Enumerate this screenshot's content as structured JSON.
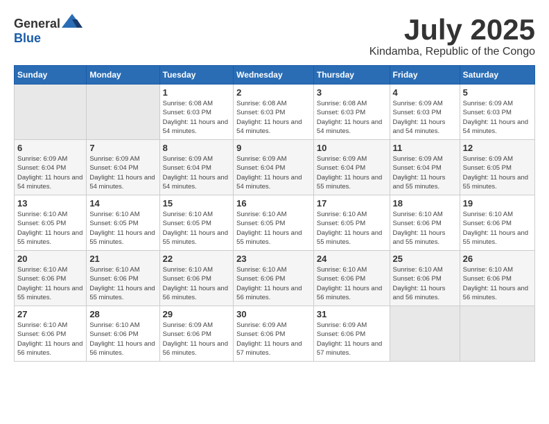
{
  "header": {
    "logo_general": "General",
    "logo_blue": "Blue",
    "month_year": "July 2025",
    "location": "Kindamba, Republic of the Congo"
  },
  "weekdays": [
    "Sunday",
    "Monday",
    "Tuesday",
    "Wednesday",
    "Thursday",
    "Friday",
    "Saturday"
  ],
  "weeks": [
    [
      {
        "day": "",
        "sunrise": "",
        "sunset": "",
        "daylight": ""
      },
      {
        "day": "",
        "sunrise": "",
        "sunset": "",
        "daylight": ""
      },
      {
        "day": "1",
        "sunrise": "Sunrise: 6:08 AM",
        "sunset": "Sunset: 6:03 PM",
        "daylight": "Daylight: 11 hours and 54 minutes."
      },
      {
        "day": "2",
        "sunrise": "Sunrise: 6:08 AM",
        "sunset": "Sunset: 6:03 PM",
        "daylight": "Daylight: 11 hours and 54 minutes."
      },
      {
        "day": "3",
        "sunrise": "Sunrise: 6:08 AM",
        "sunset": "Sunset: 6:03 PM",
        "daylight": "Daylight: 11 hours and 54 minutes."
      },
      {
        "day": "4",
        "sunrise": "Sunrise: 6:09 AM",
        "sunset": "Sunset: 6:03 PM",
        "daylight": "Daylight: 11 hours and 54 minutes."
      },
      {
        "day": "5",
        "sunrise": "Sunrise: 6:09 AM",
        "sunset": "Sunset: 6:03 PM",
        "daylight": "Daylight: 11 hours and 54 minutes."
      }
    ],
    [
      {
        "day": "6",
        "sunrise": "Sunrise: 6:09 AM",
        "sunset": "Sunset: 6:04 PM",
        "daylight": "Daylight: 11 hours and 54 minutes."
      },
      {
        "day": "7",
        "sunrise": "Sunrise: 6:09 AM",
        "sunset": "Sunset: 6:04 PM",
        "daylight": "Daylight: 11 hours and 54 minutes."
      },
      {
        "day": "8",
        "sunrise": "Sunrise: 6:09 AM",
        "sunset": "Sunset: 6:04 PM",
        "daylight": "Daylight: 11 hours and 54 minutes."
      },
      {
        "day": "9",
        "sunrise": "Sunrise: 6:09 AM",
        "sunset": "Sunset: 6:04 PM",
        "daylight": "Daylight: 11 hours and 54 minutes."
      },
      {
        "day": "10",
        "sunrise": "Sunrise: 6:09 AM",
        "sunset": "Sunset: 6:04 PM",
        "daylight": "Daylight: 11 hours and 55 minutes."
      },
      {
        "day": "11",
        "sunrise": "Sunrise: 6:09 AM",
        "sunset": "Sunset: 6:04 PM",
        "daylight": "Daylight: 11 hours and 55 minutes."
      },
      {
        "day": "12",
        "sunrise": "Sunrise: 6:09 AM",
        "sunset": "Sunset: 6:05 PM",
        "daylight": "Daylight: 11 hours and 55 minutes."
      }
    ],
    [
      {
        "day": "13",
        "sunrise": "Sunrise: 6:10 AM",
        "sunset": "Sunset: 6:05 PM",
        "daylight": "Daylight: 11 hours and 55 minutes."
      },
      {
        "day": "14",
        "sunrise": "Sunrise: 6:10 AM",
        "sunset": "Sunset: 6:05 PM",
        "daylight": "Daylight: 11 hours and 55 minutes."
      },
      {
        "day": "15",
        "sunrise": "Sunrise: 6:10 AM",
        "sunset": "Sunset: 6:05 PM",
        "daylight": "Daylight: 11 hours and 55 minutes."
      },
      {
        "day": "16",
        "sunrise": "Sunrise: 6:10 AM",
        "sunset": "Sunset: 6:05 PM",
        "daylight": "Daylight: 11 hours and 55 minutes."
      },
      {
        "day": "17",
        "sunrise": "Sunrise: 6:10 AM",
        "sunset": "Sunset: 6:05 PM",
        "daylight": "Daylight: 11 hours and 55 minutes."
      },
      {
        "day": "18",
        "sunrise": "Sunrise: 6:10 AM",
        "sunset": "Sunset: 6:06 PM",
        "daylight": "Daylight: 11 hours and 55 minutes."
      },
      {
        "day": "19",
        "sunrise": "Sunrise: 6:10 AM",
        "sunset": "Sunset: 6:06 PM",
        "daylight": "Daylight: 11 hours and 55 minutes."
      }
    ],
    [
      {
        "day": "20",
        "sunrise": "Sunrise: 6:10 AM",
        "sunset": "Sunset: 6:06 PM",
        "daylight": "Daylight: 11 hours and 55 minutes."
      },
      {
        "day": "21",
        "sunrise": "Sunrise: 6:10 AM",
        "sunset": "Sunset: 6:06 PM",
        "daylight": "Daylight: 11 hours and 55 minutes."
      },
      {
        "day": "22",
        "sunrise": "Sunrise: 6:10 AM",
        "sunset": "Sunset: 6:06 PM",
        "daylight": "Daylight: 11 hours and 56 minutes."
      },
      {
        "day": "23",
        "sunrise": "Sunrise: 6:10 AM",
        "sunset": "Sunset: 6:06 PM",
        "daylight": "Daylight: 11 hours and 56 minutes."
      },
      {
        "day": "24",
        "sunrise": "Sunrise: 6:10 AM",
        "sunset": "Sunset: 6:06 PM",
        "daylight": "Daylight: 11 hours and 56 minutes."
      },
      {
        "day": "25",
        "sunrise": "Sunrise: 6:10 AM",
        "sunset": "Sunset: 6:06 PM",
        "daylight": "Daylight: 11 hours and 56 minutes."
      },
      {
        "day": "26",
        "sunrise": "Sunrise: 6:10 AM",
        "sunset": "Sunset: 6:06 PM",
        "daylight": "Daylight: 11 hours and 56 minutes."
      }
    ],
    [
      {
        "day": "27",
        "sunrise": "Sunrise: 6:10 AM",
        "sunset": "Sunset: 6:06 PM",
        "daylight": "Daylight: 11 hours and 56 minutes."
      },
      {
        "day": "28",
        "sunrise": "Sunrise: 6:10 AM",
        "sunset": "Sunset: 6:06 PM",
        "daylight": "Daylight: 11 hours and 56 minutes."
      },
      {
        "day": "29",
        "sunrise": "Sunrise: 6:09 AM",
        "sunset": "Sunset: 6:06 PM",
        "daylight": "Daylight: 11 hours and 56 minutes."
      },
      {
        "day": "30",
        "sunrise": "Sunrise: 6:09 AM",
        "sunset": "Sunset: 6:06 PM",
        "daylight": "Daylight: 11 hours and 57 minutes."
      },
      {
        "day": "31",
        "sunrise": "Sunrise: 6:09 AM",
        "sunset": "Sunset: 6:06 PM",
        "daylight": "Daylight: 11 hours and 57 minutes."
      },
      {
        "day": "",
        "sunrise": "",
        "sunset": "",
        "daylight": ""
      },
      {
        "day": "",
        "sunrise": "",
        "sunset": "",
        "daylight": ""
      }
    ]
  ]
}
